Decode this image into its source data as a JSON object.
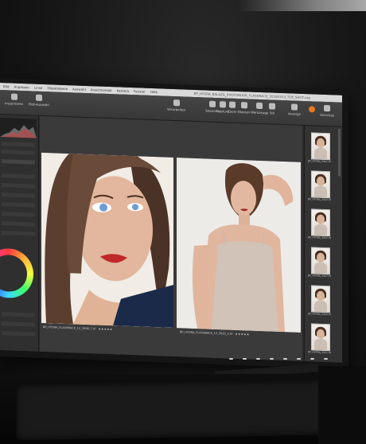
{
  "app": {
    "menu_items": [
      "Bild",
      "Anpassen",
      "Linse",
      "Objektebene",
      "Auswahl",
      "Ansichtsmodi",
      "Kamera",
      "Fenster",
      "Hilfe"
    ],
    "window_title": "BP_HYDRA_BALAZ&_PHOTOBOOK_FLASHBACK_20180313_TOP_SHOT.cop"
  },
  "toolbar": {
    "left_item_label": "Importieren",
    "left_item2_label": "Bild-Auswahl",
    "tool_labels": [
      "Sessions",
      "Capture",
      "Zoom",
      "Ebenen",
      "Werkzeuge",
      "Stil",
      "Anzeige",
      "Vorschau"
    ],
    "process_label": "Verarbeiten"
  },
  "viewer": {
    "caption_a": "BP_HYDRA_FLASHBACK_12_3908_7.tif",
    "caption_b": "BP_HYDRA_FLASHBACK_12_3910_3.tif",
    "stars": "★★★★★"
  },
  "filmstrip": {
    "items": [
      {
        "label": "BP_HYDRA_3901.tif"
      },
      {
        "label": "BP_HYDRA_3903.tif"
      },
      {
        "label": "BP_HYDRA_3905.tif"
      },
      {
        "label": "BP_HYDRA_3907.tif"
      },
      {
        "label": "BP_HYDRA_3909.tif"
      },
      {
        "label": "BP_HYDRA_3911.tif"
      }
    ]
  },
  "colors": {
    "accent": "#e87a20",
    "screen_bg": "#2a2a2a",
    "viewer_bg": "#3a3a3a"
  }
}
